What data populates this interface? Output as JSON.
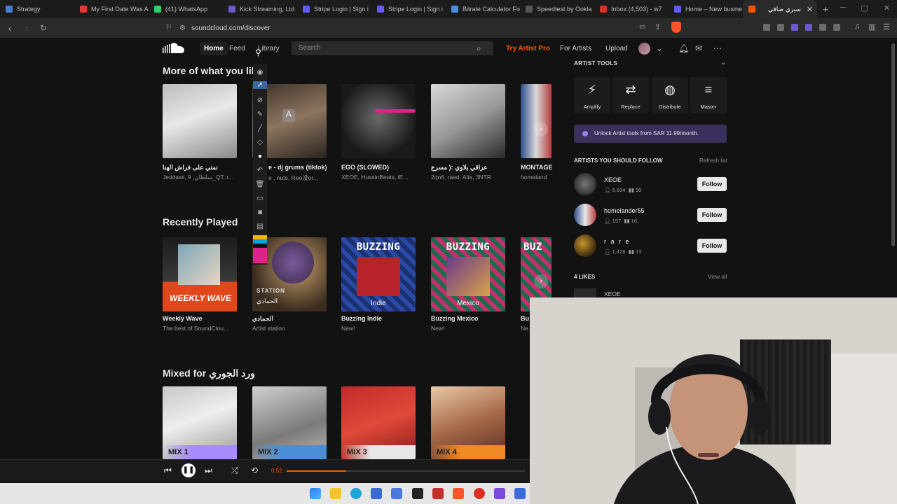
{
  "browser": {
    "tabs": [
      {
        "label": "Strategy",
        "color": "#4a7bd6"
      },
      {
        "label": "My First Date Was A",
        "color": "#e53935"
      },
      {
        "label": "(41) WhatsApp",
        "color": "#25d366"
      },
      {
        "label": "Kick Streaming, Ltd",
        "color": "#6a5acd"
      },
      {
        "label": "Stripe Login | Sign i",
        "color": "#635bff"
      },
      {
        "label": "Stripe Login | Sign i",
        "color": "#635bff"
      },
      {
        "label": "Bitrate Calculator Fo",
        "color": "#4a90e2"
      },
      {
        "label": "Speedtest by Ookla",
        "color": "#333333"
      },
      {
        "label": "Inbox (4,503) - w7",
        "color": "#d93025"
      },
      {
        "label": "Home – New busine",
        "color": "#635bff"
      },
      {
        "label": "سيري صافي",
        "color": "#ff5500"
      }
    ],
    "new_tab": "+",
    "url": "soundcloud.com/discover"
  },
  "header": {
    "nav_home": "Home",
    "nav_feed": "Feed",
    "nav_library": "Library",
    "search_placeholder": "Search",
    "try_pro": "Try Artist Pro",
    "for_artists": "For Artists",
    "upload": "Upload"
  },
  "sections": {
    "more_title": "More of what you like",
    "more_cards": [
      {
        "title": "نمتي على فراش الهنا",
        "sub": "Jeddawi, 9 ,سلطان_QT, r..."
      },
      {
        "title": "e - dj grums (tiktok)",
        "sub": "e , nuts, Reo没or..."
      },
      {
        "title": "EGO (SLOWED)",
        "sub": "XEOE, HussinBeats, iE..."
      },
      {
        "title": "عراقي بلاوي :( مسرع",
        "sub": "2qn6, raed, Alia, 3NTR"
      },
      {
        "title": "MONTAGE",
        "sub": "homeland"
      }
    ],
    "recent_title": "Recently Played",
    "recent_cards": [
      {
        "title": "Weekly Wave",
        "sub": "The best of SoundClou...",
        "overlay": "WEEKLY WAVE"
      },
      {
        "title": "الحمادي",
        "sub": "Artist station",
        "overlay": "STATION",
        "overlay2": "الحمادي"
      },
      {
        "title": "Buzzing Indie",
        "sub": "New!",
        "overlay": "BUZZING",
        "overlay2": "Indie"
      },
      {
        "title": "Buzzing Mexico",
        "sub": "New!",
        "overlay": "BUZZING",
        "overlay2": "Mexico"
      },
      {
        "title": "Bu",
        "sub": "Ne",
        "overlay": "BUZ"
      }
    ],
    "mixed_title": "Mixed for ورد الجوري",
    "mixed_cards": [
      {
        "label": "MIX 1",
        "color": "#a78bfa"
      },
      {
        "label": "MIX 2",
        "color": "#4a8fd6"
      },
      {
        "label": "MIX 3",
        "color": "#e8e8e8"
      },
      {
        "label": "MIX 4",
        "color": "#f08a24"
      }
    ]
  },
  "sidebar": {
    "artist_tools_title": "ARTIST TOOLS",
    "tools": [
      "Amplify",
      "Replace",
      "Distribute",
      "Master"
    ],
    "unlock_text": "Unlock Artist tools from SAR 11.99/month.",
    "follow_title": "ARTISTS YOU SHOULD FOLLOW",
    "refresh": "Refresh list",
    "artists": [
      {
        "name": "XEOE",
        "followers": "5,634",
        "tracks": "99"
      },
      {
        "name": "homelander55",
        "followers": "157",
        "tracks": "16"
      },
      {
        "name": "r a r e",
        "followers": "1,428",
        "tracks": "13"
      }
    ],
    "follow_label": "Follow",
    "likes_title": "4 LIKES",
    "view_all": "View all",
    "like_item": "XEOE"
  },
  "player": {
    "time": "0:52",
    "progress": 0.25
  },
  "colors": {
    "accent": "#ff5500",
    "page_bg": "#121212"
  }
}
